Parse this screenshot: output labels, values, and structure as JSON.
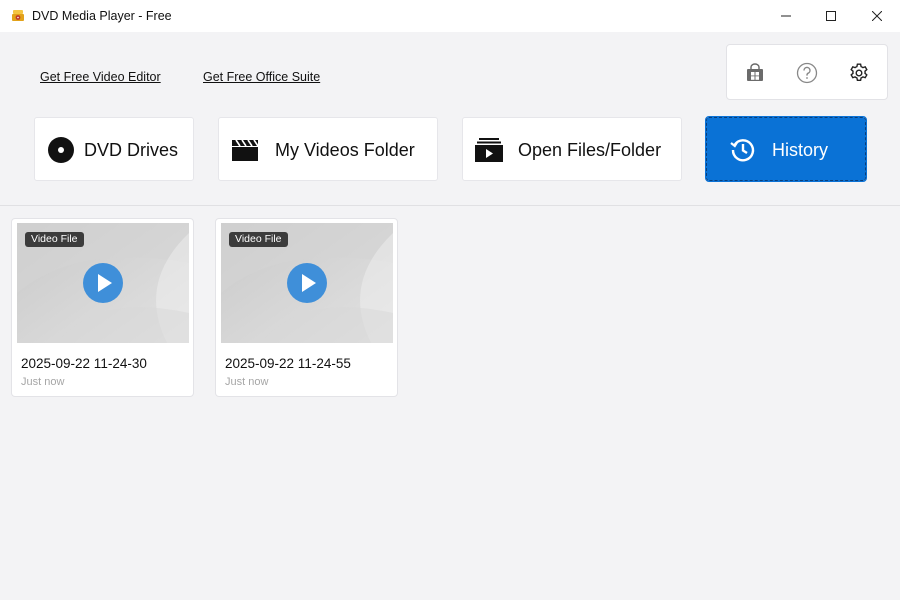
{
  "window": {
    "title": "DVD Media Player - Free",
    "controls": [
      "minimize",
      "maximize",
      "close"
    ]
  },
  "header": {
    "links": {
      "video_editor": "Get Free Video Editor",
      "office_suite": "Get Free Office Suite"
    },
    "utility_icons": [
      "store-icon",
      "help-icon",
      "settings-icon"
    ],
    "nav": [
      {
        "label": "DVD Drives",
        "icon": "disc-icon",
        "active": false
      },
      {
        "label": "My Videos Folder",
        "icon": "clapperboard-icon",
        "active": false
      },
      {
        "label": "Open Files/Folder",
        "icon": "open-folder-icon",
        "active": false
      },
      {
        "label": "History",
        "icon": "history-icon",
        "active": true
      }
    ]
  },
  "history": {
    "items": [
      {
        "badge": "Video File",
        "name": "2025-09-22 11-24-30",
        "time": "Just now"
      },
      {
        "badge": "Video File",
        "name": "2025-09-22 11-24-55",
        "time": "Just now"
      }
    ]
  },
  "colors": {
    "accent": "#0a72d6",
    "play_button": "#3f8fd9",
    "background": "#f3f3f5"
  }
}
